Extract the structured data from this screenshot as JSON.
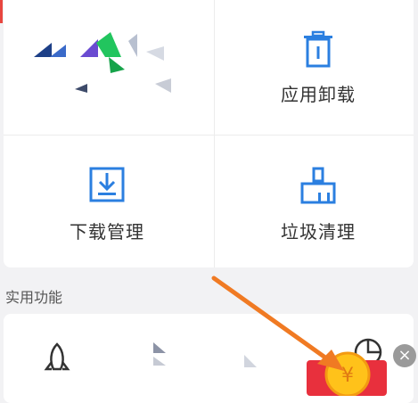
{
  "tiles": [
    {
      "label": "",
      "icon": "app-icon"
    },
    {
      "label": "应用卸载",
      "icon": "trash-icon"
    },
    {
      "label": "下载管理",
      "icon": "download-icon"
    },
    {
      "label": "垃圾清理",
      "icon": "broom-icon"
    }
  ],
  "section": {
    "title": "实用功能"
  },
  "close_label": "×",
  "colors": {
    "accent": "#2b7fe0",
    "annotation_arrow": "#f07a23",
    "red_packet": "#e8303d"
  }
}
